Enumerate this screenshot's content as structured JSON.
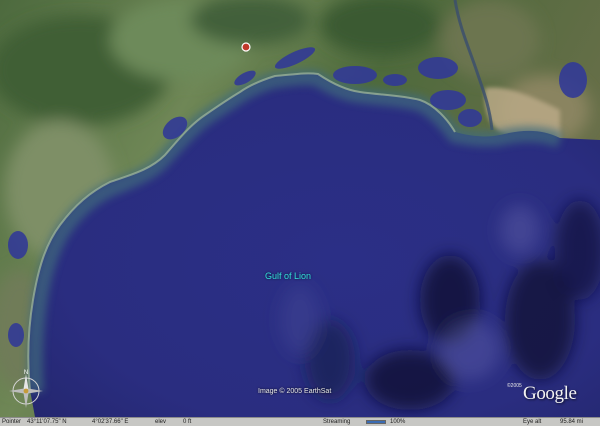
{
  "map": {
    "place_label": "Gulf of Lion",
    "imagery_copyright": "Image © 2005 EarthSat",
    "logo_copyright": "©2005",
    "logo_text": "Google",
    "colors": {
      "sea": "#2b2f86",
      "shallow_water": "#3f6b7d",
      "coast": "#7f9f7e",
      "land": "#5f7a4c",
      "lagoon": "#323a96",
      "pin": "#c0392b"
    },
    "compass": {
      "north": "N",
      "icon": "compass-rose-icon"
    }
  },
  "statusbar": {
    "pointer_label": "Pointer",
    "pointer_lat": "43°11'07.75\" N",
    "pointer_lon": "4°02'37.66\" E",
    "elev_label": "elev",
    "elev_value": "0 ft",
    "streaming_label": "Streaming",
    "streaming_percent": 100,
    "streaming_value": "100%",
    "eye_label": "Eye alt",
    "eye_value": "95.84 mi"
  }
}
